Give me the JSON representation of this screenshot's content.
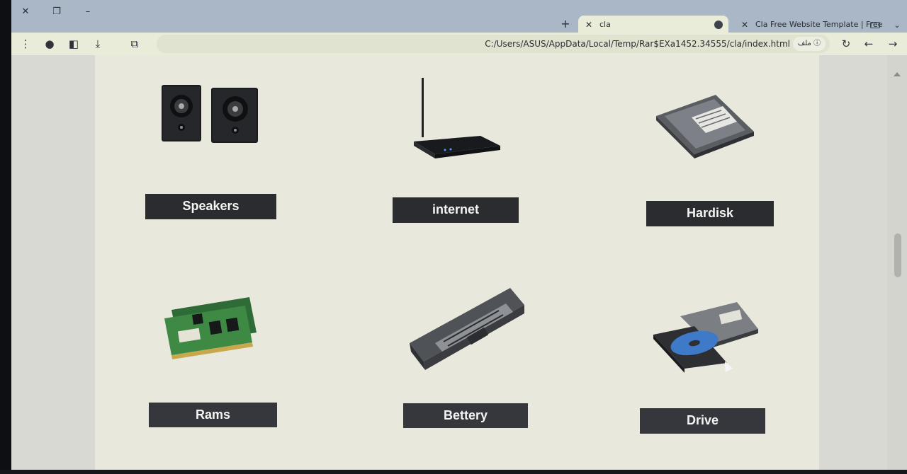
{
  "browser": {
    "tabs": [
      {
        "title": "cla",
        "active": true
      },
      {
        "title": "Cla Free Website Template | Free",
        "active": false
      }
    ],
    "address": "C:/Users/ASUS/AppData/Local/Temp/Rar$EXa1452.34555/cla/index.html",
    "site_info_label": "ملف"
  },
  "products": [
    {
      "label": "Speakers",
      "icon": "speakers-image"
    },
    {
      "label": "internet",
      "icon": "router-image"
    },
    {
      "label": "Hardisk",
      "icon": "hard-disk-image"
    },
    {
      "label": "Rams",
      "icon": "ram-modules-image"
    },
    {
      "label": "Bettery",
      "icon": "laptop-battery-image"
    },
    {
      "label": "Drive",
      "icon": "optical-drive-image"
    }
  ],
  "colors": {
    "page_background": "#e9e8dc",
    "label_background": "#2b2c30",
    "label_text": "#f4f4f2"
  }
}
